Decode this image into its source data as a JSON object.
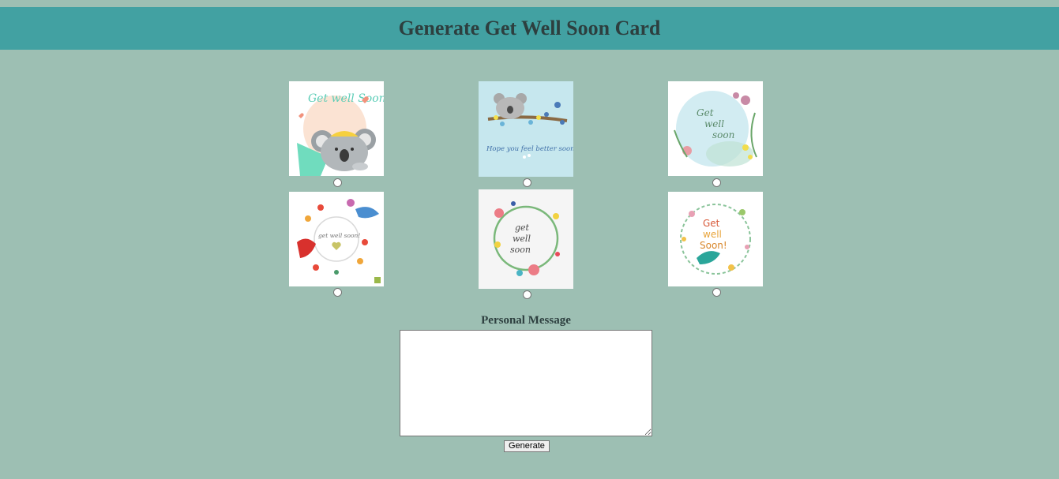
{
  "header": {
    "title": "Generate Get Well Soon Card"
  },
  "cards": [
    {
      "id": "card-1",
      "text": "Get well Soon",
      "theme": "koala-blanket"
    },
    {
      "id": "card-2",
      "text": "Hope you feel better soon",
      "theme": "koala-branch"
    },
    {
      "id": "card-3",
      "text": "Get well soon",
      "theme": "watercolor-wreath"
    },
    {
      "id": "card-4",
      "text": "get well soon!",
      "theme": "birds-flowers"
    },
    {
      "id": "card-5",
      "text": "get well soon",
      "theme": "floral-wreath"
    },
    {
      "id": "card-6",
      "text": "Get well Soon!",
      "theme": "bird-wreath"
    }
  ],
  "form": {
    "message_label": "Personal Message",
    "message_value": "",
    "generate_label": "Generate"
  },
  "colors": {
    "background": "#9dbfb3",
    "header": "#42a1a2",
    "title_text": "#2d3f3f"
  }
}
